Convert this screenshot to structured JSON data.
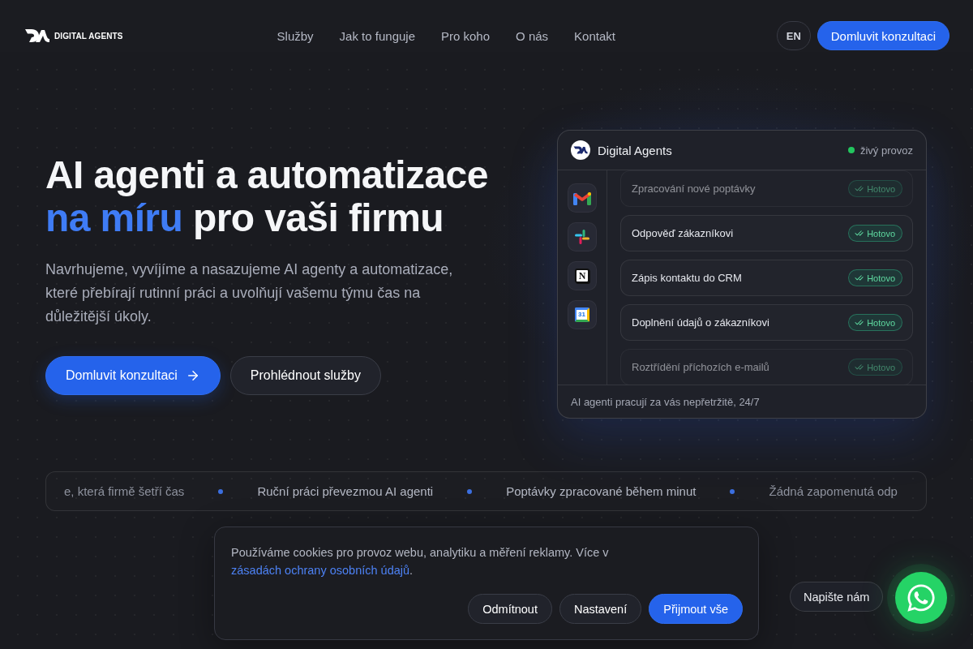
{
  "header": {
    "logo_text": "DIGITAL AGENTS",
    "nav": [
      "Služby",
      "Jak to funguje",
      "Pro koho",
      "O nás",
      "Kontakt"
    ],
    "language": "EN",
    "cta": "Domluvit konzultaci"
  },
  "hero": {
    "title_lines": [
      [
        {
          "text": "AI agenti a automatizace",
          "accent": false
        }
      ],
      [
        {
          "text": "na míru",
          "accent": true
        },
        {
          "text": "pro vaši firmu",
          "accent": false
        }
      ]
    ],
    "description": "Navrhujeme, vyvíjíme a nasazujeme AI agenty a automatizace, které přebírají rutinní práci a uvolňují vašemu týmu čas na důležitější úkoly.",
    "primary_button": "Domluvit konzultaci",
    "secondary_button": "Prohlédnout služby"
  },
  "agent_card": {
    "title": "Digital Agents",
    "status": {
      "label": "živý provoz",
      "live": true
    },
    "apps": [
      {
        "kind": "mail"
      },
      {
        "kind": "chat"
      },
      {
        "kind": "notes",
        "glyph": "N"
      },
      {
        "kind": "calendar",
        "glyph": "31"
      }
    ],
    "tasks": [
      {
        "label": "Zpracování nové poptávky",
        "status": "Hotovo",
        "done": true
      },
      {
        "label": "Odpověď zákazníkovi",
        "status": "Hotovo",
        "done": true
      },
      {
        "label": "Zápis kontaktu do CRM",
        "status": "Hotovo",
        "done": true
      },
      {
        "label": "Doplnění údajů o zákazníkovi",
        "status": "Hotovo",
        "done": true
      },
      {
        "label": "Roztřídění příchozích e-mailů",
        "status": "Hotovo",
        "done": true
      }
    ],
    "footer": "AI agenti pracují za vás nepřetržitě, 24/7"
  },
  "ticker": [
    "e, která firmě šetří čas",
    "Ruční práci převezmou AI agenti",
    "Poptávky zpracované během minut",
    "Žádná zapomenutá odp"
  ],
  "cookie_banner": {
    "text": "Používáme cookies pro provoz webu, analytiku a měření reklamy. Více v",
    "link": "zásadách ochrany osobních údajů",
    "text_end": ".",
    "buttons": [
      {
        "label": "Odmítnout",
        "kind": "secondary"
      },
      {
        "label": "Nastavení",
        "kind": "secondary"
      },
      {
        "label": "Přijmout vše",
        "kind": "primary"
      }
    ]
  },
  "chat_widget": {
    "label": "Napište nám"
  }
}
